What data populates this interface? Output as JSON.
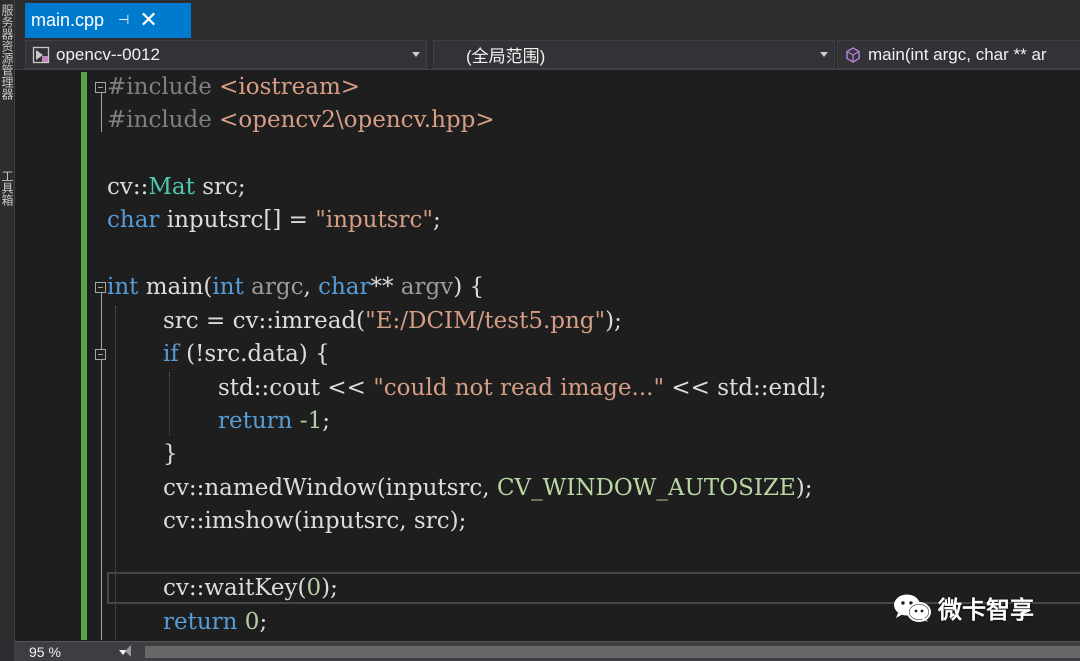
{
  "side_panel": {
    "label_top": "服务器资源管理器",
    "label_bottom": "工具箱"
  },
  "tab": {
    "title": "main.cpp",
    "pin_glyph": "⊣",
    "close_glyph": "✕"
  },
  "nav": {
    "project": "opencv--0012",
    "scope": "(全局范围)",
    "member": "main(int argc, char ** ar"
  },
  "code": {
    "line1": "#include <iostream>",
    "line2": "#include <opencv2\\opencv.hpp>",
    "line3": "",
    "line4": "cv::Mat src;",
    "line5": "char inputsrc[] = \"inputsrc\";",
    "line6": "",
    "line7": "int main(int argc, char** argv) {",
    "line8": "src = cv::imread(\"E:/DCIM/test5.png\");",
    "line9": "if (!src.data) {",
    "line10": "std::cout << \"could not read image...\" << std::endl;",
    "line11": "return -1;",
    "line12": "}",
    "line13": "cv::namedWindow(inputsrc, CV_WINDOW_AUTOSIZE);",
    "line14": "cv::imshow(inputsrc, src);",
    "line15": "",
    "line16": "cv::waitKey(0);",
    "line17": "return 0;"
  },
  "status": {
    "zoom": "95 %"
  },
  "watermark": {
    "text": "微卡智享"
  },
  "colors": {
    "accent": "#007acc",
    "keyword": "#569cd6",
    "string": "#d69d85",
    "type": "#4ec9b0",
    "macro": "#b8d7a3",
    "change_bar": "#57a64a"
  },
  "icons": {
    "project": "project-icon",
    "member": "member-function-icon",
    "watermark": "wechat-icon"
  }
}
